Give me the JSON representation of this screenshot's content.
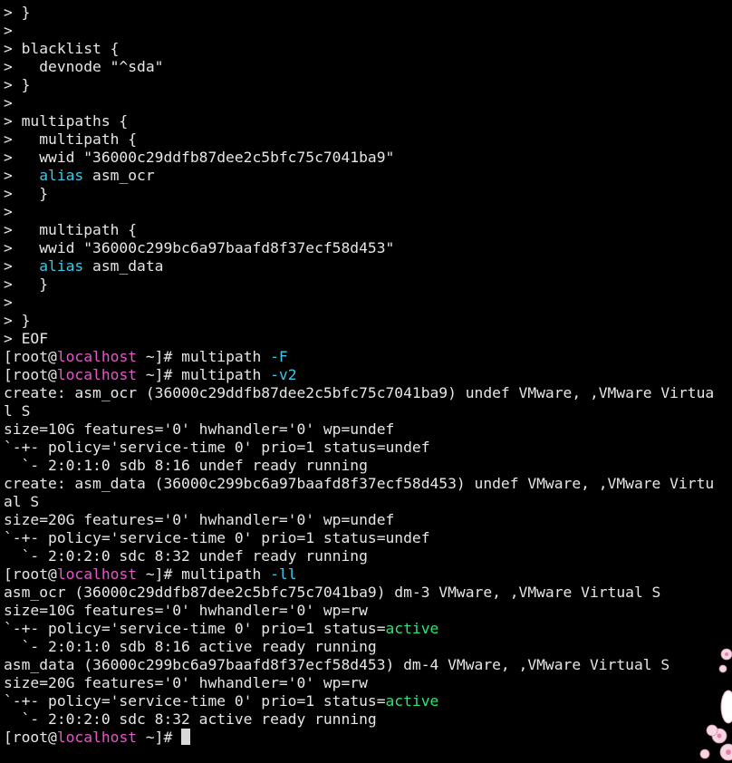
{
  "terminal": {
    "lines": [
      [
        {
          "t": "> }",
          "c": ""
        }
      ],
      [
        {
          "t": ">",
          "c": ""
        }
      ],
      [
        {
          "t": "> blacklist {",
          "c": ""
        }
      ],
      [
        {
          "t": ">   devnode \"^sda\"",
          "c": ""
        }
      ],
      [
        {
          "t": "> }",
          "c": ""
        }
      ],
      [
        {
          "t": ">",
          "c": ""
        }
      ],
      [
        {
          "t": "> multipaths {",
          "c": ""
        }
      ],
      [
        {
          "t": ">   multipath {",
          "c": ""
        }
      ],
      [
        {
          "t": ">   wwid \"36000c29ddfb87dee2c5bfc75c7041ba9\"",
          "c": ""
        }
      ],
      [
        {
          "t": ">   ",
          "c": ""
        },
        {
          "t": "alias",
          "c": "kw"
        },
        {
          "t": " asm_ocr",
          "c": ""
        }
      ],
      [
        {
          "t": ">   }",
          "c": ""
        }
      ],
      [
        {
          "t": ">",
          "c": ""
        }
      ],
      [
        {
          "t": ">   multipath {",
          "c": ""
        }
      ],
      [
        {
          "t": ">   wwid \"36000c299bc6a97baafd8f37ecf58d453\"",
          "c": ""
        }
      ],
      [
        {
          "t": ">   ",
          "c": ""
        },
        {
          "t": "alias",
          "c": "kw"
        },
        {
          "t": " asm_data",
          "c": ""
        }
      ],
      [
        {
          "t": ">   }",
          "c": ""
        }
      ],
      [
        {
          "t": ">",
          "c": ""
        }
      ],
      [
        {
          "t": "> }",
          "c": ""
        }
      ],
      [
        {
          "t": "> EOF",
          "c": ""
        }
      ],
      [
        {
          "t": "[root@",
          "c": ""
        },
        {
          "t": "localhost",
          "c": "host"
        },
        {
          "t": " ~]# multipath ",
          "c": ""
        },
        {
          "t": "-F",
          "c": "flag"
        }
      ],
      [
        {
          "t": "[root@",
          "c": ""
        },
        {
          "t": "localhost",
          "c": "host"
        },
        {
          "t": " ~]# multipath ",
          "c": ""
        },
        {
          "t": "-v2",
          "c": "flag"
        }
      ],
      [
        {
          "t": "create: asm_ocr (36000c29ddfb87dee2c5bfc75c7041ba9) undef VMware, ,VMware Virtua",
          "c": ""
        }
      ],
      [
        {
          "t": "l S",
          "c": ""
        }
      ],
      [
        {
          "t": "size=10G features='0' hwhandler='0' wp=undef",
          "c": ""
        }
      ],
      [
        {
          "t": "`-+- policy='service-time 0' prio=1 status=undef",
          "c": ""
        }
      ],
      [
        {
          "t": "  `- 2:0:1:0 sdb 8:16 undef ready running",
          "c": ""
        }
      ],
      [
        {
          "t": "create: asm_data (36000c299bc6a97baafd8f37ecf58d453) undef VMware, ,VMware Virtu",
          "c": ""
        }
      ],
      [
        {
          "t": "al S",
          "c": ""
        }
      ],
      [
        {
          "t": "size=20G features='0' hwhandler='0' wp=undef",
          "c": ""
        }
      ],
      [
        {
          "t": "`-+- policy='service-time 0' prio=1 status=undef",
          "c": ""
        }
      ],
      [
        {
          "t": "  `- 2:0:2:0 sdc 8:32 undef ready running",
          "c": ""
        }
      ],
      [
        {
          "t": "[root@",
          "c": ""
        },
        {
          "t": "localhost",
          "c": "host"
        },
        {
          "t": " ~]# multipath ",
          "c": ""
        },
        {
          "t": "-ll",
          "c": "flag"
        }
      ],
      [
        {
          "t": "asm_ocr (36000c29ddfb87dee2c5bfc75c7041ba9) dm-3 VMware, ,VMware Virtual S",
          "c": ""
        }
      ],
      [
        {
          "t": "size=10G features='0' hwhandler='0' wp=rw",
          "c": ""
        }
      ],
      [
        {
          "t": "`-+- policy='service-time 0' prio=1 status=",
          "c": ""
        },
        {
          "t": "active",
          "c": "ok"
        }
      ],
      [
        {
          "t": "  `- 2:0:1:0 sdb 8:16 active ready running",
          "c": ""
        }
      ],
      [
        {
          "t": "asm_data (36000c299bc6a97baafd8f37ecf58d453) dm-4 VMware, ,VMware Virtual S",
          "c": ""
        }
      ],
      [
        {
          "t": "size=20G features='0' hwhandler='0' wp=rw",
          "c": ""
        }
      ],
      [
        {
          "t": "`-+- policy='service-time 0' prio=1 status=",
          "c": ""
        },
        {
          "t": "active",
          "c": "ok"
        }
      ],
      [
        {
          "t": "  `- 2:0:2:0 sdc 8:32 active ready running",
          "c": ""
        }
      ],
      [
        {
          "t": "[root@",
          "c": ""
        },
        {
          "t": "localhost",
          "c": "host"
        },
        {
          "t": " ~]# ",
          "c": ""
        }
      ]
    ],
    "colors": {
      "background": "#000000",
      "foreground": "#e6e6e6",
      "keyword": "#3ec7e8",
      "hostname": "#e458c8",
      "status_active": "#2fe07a",
      "cursor": "#d9d9d9"
    },
    "cursor_icon": "block-cursor-icon",
    "decoration_icon": "flower-wallpaper-icon"
  }
}
